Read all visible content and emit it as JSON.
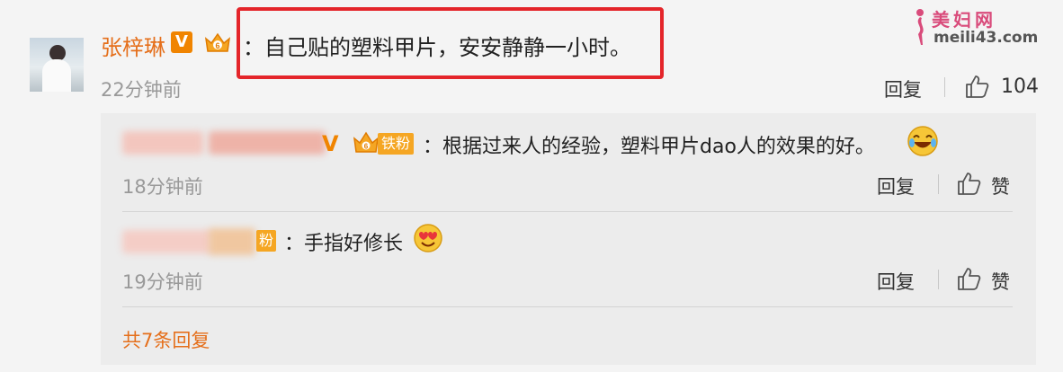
{
  "watermark": {
    "title": "美妇网",
    "url": "meili43.com"
  },
  "main_comment": {
    "username": "张梓琳",
    "verified_badge": "V",
    "text": "：自己贴的塑料甲片，安安静静一小时。",
    "time": "22分钟前",
    "reply_label": "回复",
    "like_count": "104"
  },
  "replies": [
    {
      "badge_text": "铁粉",
      "text": "：根据过来人的经验，塑料甲片dao人的效果的好。",
      "time": "18分钟前",
      "reply_label": "回复",
      "like_label": "赞"
    },
    {
      "badge_text": "粉",
      "text": "：手指好修长",
      "time": "19分钟前",
      "reply_label": "回复",
      "like_label": "赞"
    }
  ],
  "more_replies": "共7条回复",
  "colors": {
    "accent": "#e56f1b",
    "highlight": "#e4252a",
    "badge": "#f08400"
  }
}
